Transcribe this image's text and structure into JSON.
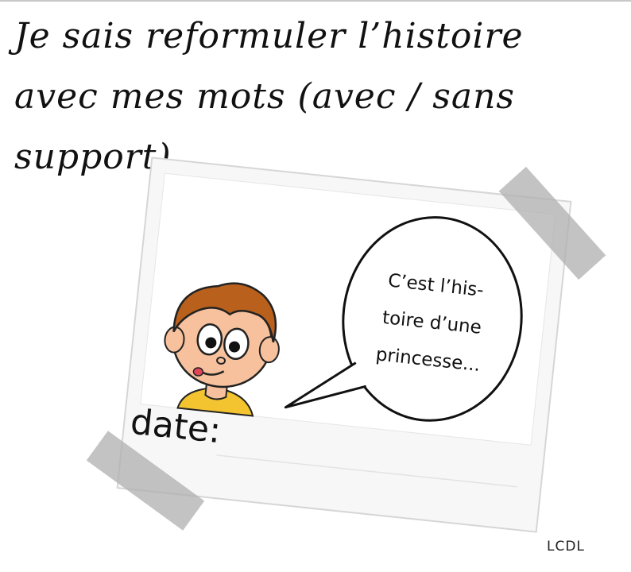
{
  "title": "Je sais reformuler l’histoire avec mes mots (avec / sans support).",
  "speech_bubble": "C’est l’his-\ntoire d’une\nprincesse...",
  "date_label": "date:",
  "credit": "LCDL",
  "colors": {
    "text": "#111111",
    "tape": "#afafaf",
    "photo_frame": "#f7f7f7",
    "hair": "#b8601c",
    "skin": "#f6c19c",
    "shirt": "#f4c430"
  }
}
